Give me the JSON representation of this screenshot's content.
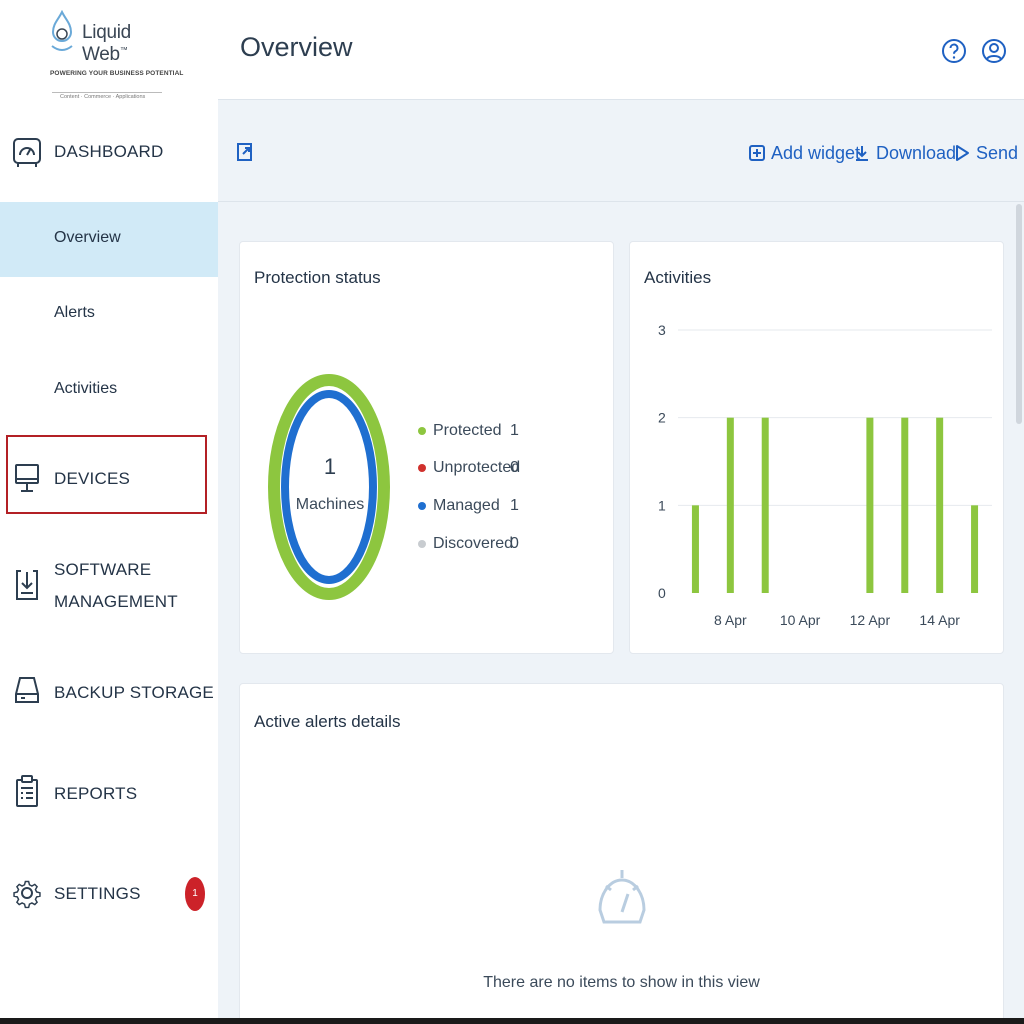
{
  "brand": {
    "name": "Liquid Web",
    "trademark": "™",
    "tagline": "POWERING YOUR BUSINESS POTENTIAL",
    "subtagline": "Content · Commerce · Applications"
  },
  "header": {
    "title": "Overview",
    "help_icon": "help-circle-icon",
    "user_icon": "user-account-icon"
  },
  "sidebar": {
    "dashboard": {
      "label": "DASHBOARD",
      "icon": "speedometer-icon"
    },
    "sub_items": [
      {
        "label": "Overview",
        "active": true
      },
      {
        "label": "Alerts",
        "active": false
      },
      {
        "label": "Activities",
        "active": false
      }
    ],
    "devices": {
      "label": "DEVICES",
      "icon": "monitor-icon",
      "highlight_color": "#b32025"
    },
    "software": {
      "label_line1": "SOFTWARE",
      "label_line2": "MANAGEMENT",
      "icon": "software-download-icon"
    },
    "backup": {
      "label": "BACKUP STORAGE",
      "icon": "storage-drive-icon"
    },
    "reports": {
      "label": "REPORTS",
      "icon": "clipboard-report-icon"
    },
    "settings": {
      "label": "SETTINGS",
      "icon": "gear-icon",
      "badge": "1"
    }
  },
  "toolbar": {
    "fullscreen_icon": "expand-icon",
    "add_widget_label": "Add widget",
    "download_label": "Download",
    "send_label": "Send"
  },
  "protection": {
    "title": "Protection status",
    "center_value": "1",
    "center_label": "Machines",
    "legend": [
      {
        "label": "Protected",
        "value": "1",
        "color": "#8dc63f"
      },
      {
        "label": "Unprotected",
        "value": "0",
        "color": "#d0312d"
      },
      {
        "label": "Managed",
        "value": "1",
        "color": "#1f6fd0"
      },
      {
        "label": "Discovered",
        "value": "0",
        "color": "#c8ccd0"
      }
    ]
  },
  "activities": {
    "title": "Activities",
    "bar_color": "#8dc63f"
  },
  "chart_data": {
    "type": "bar",
    "categories": [
      "7 Apr",
      "8 Apr",
      "9 Apr",
      "10 Apr",
      "11 Apr",
      "12 Apr",
      "13 Apr",
      "14 Apr",
      "15 Apr"
    ],
    "values": [
      1,
      2,
      2,
      0,
      0,
      2,
      2,
      2,
      1
    ],
    "tick_labels": [
      "8 Apr",
      "10 Apr",
      "12 Apr",
      "14 Apr"
    ],
    "y_ticks": [
      "0",
      "1",
      "2",
      "3"
    ],
    "ylim": [
      0,
      3
    ],
    "grid": true
  },
  "alerts": {
    "title": "Active alerts details",
    "empty_icon": "gauge-empty-icon",
    "empty_text": "There are no items to show in this view"
  }
}
